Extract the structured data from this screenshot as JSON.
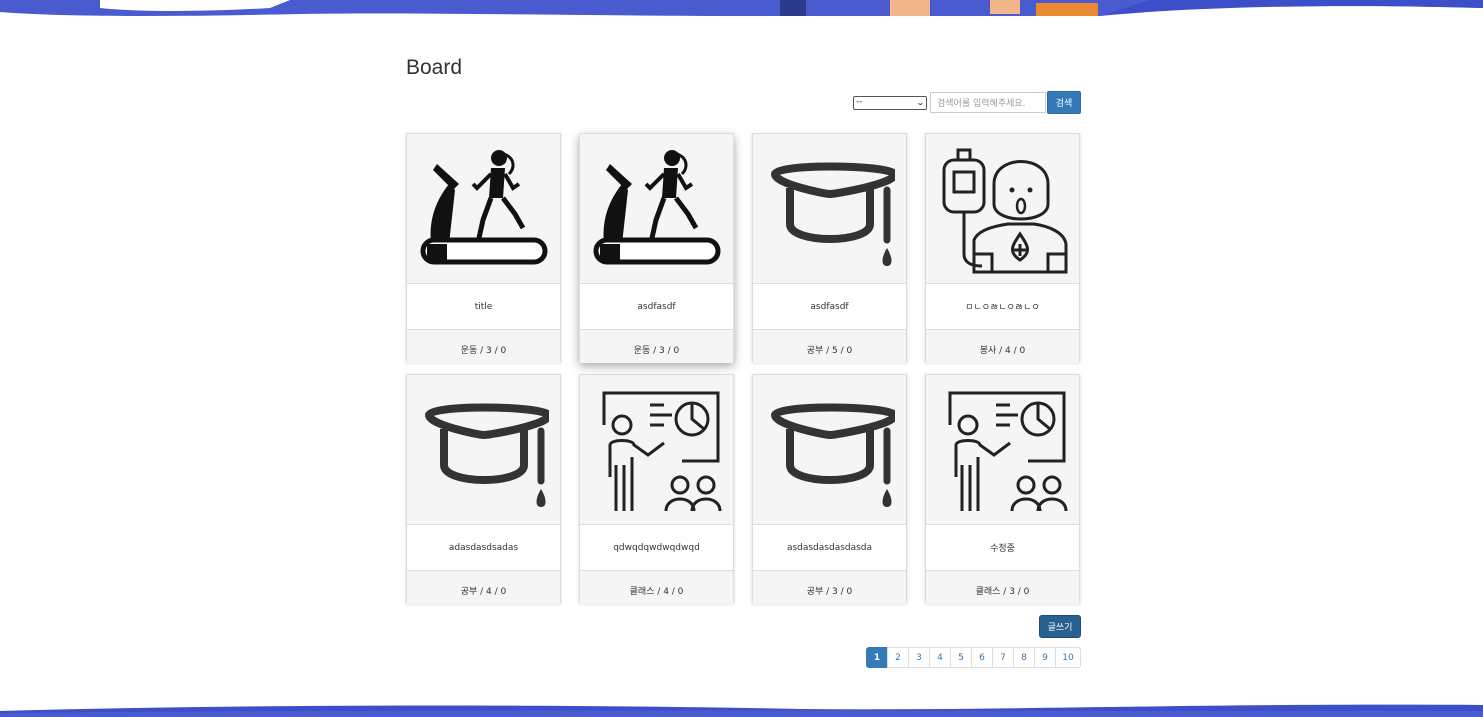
{
  "page": {
    "title": "Board"
  },
  "search": {
    "select_value": "--",
    "placeholder": "검색어를 입력해주세요.",
    "button_label": "검색"
  },
  "cards": [
    {
      "icon": "treadmill-runner-icon",
      "title": "title",
      "meta": "운동 / 3 / 0"
    },
    {
      "icon": "treadmill-runner-icon",
      "title": "asdfasdf",
      "meta": "운동 / 3 / 0"
    },
    {
      "icon": "graduation-cap-icon",
      "title": "asdfasdf",
      "meta": "공부 / 5 / 0"
    },
    {
      "icon": "blood-donor-icon",
      "title": "ㅁㄴㅇㅀㄴㅇㅀㄴㅇ",
      "meta": "봉사 / 4 / 0"
    },
    {
      "icon": "graduation-cap-icon",
      "title": "adasdasdsadas",
      "meta": "공부 / 4 / 0"
    },
    {
      "icon": "teacher-presentation-icon",
      "title": "qdwqdqwdwqdwqd",
      "meta": "클래스 / 4 / 0"
    },
    {
      "icon": "graduation-cap-icon",
      "title": "asdasdasdasdasda",
      "meta": "공부 / 3 / 0"
    },
    {
      "icon": "teacher-presentation-icon",
      "title": "수정중",
      "meta": "클래스 / 3 / 0"
    }
  ],
  "write_button_label": "글쓰기",
  "pagination": [
    "1",
    "2",
    "3",
    "4",
    "5",
    "6",
    "7",
    "8",
    "9",
    "10"
  ],
  "colors": {
    "primary": "#337ab7",
    "banner": "#4a5bd0"
  }
}
